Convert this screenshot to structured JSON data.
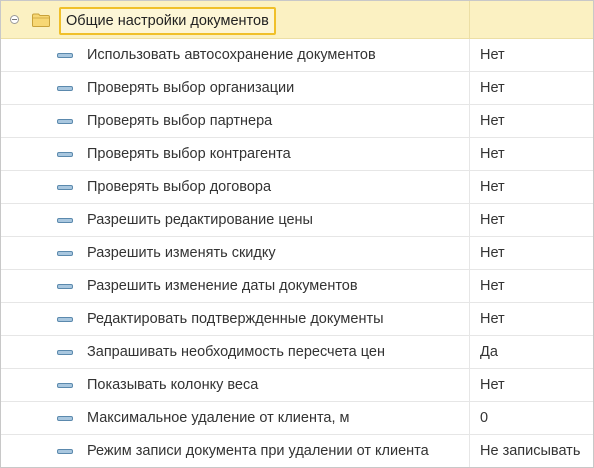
{
  "group": {
    "label": "Общие настройки документов",
    "expanded": true,
    "icon": "folder-icon",
    "accent_color": "#f0c02a",
    "background_color": "#fbf1c2"
  },
  "items": [
    {
      "label": "Использовать автосохранение документов",
      "value": "Нет"
    },
    {
      "label": "Проверять выбор организации",
      "value": "Нет"
    },
    {
      "label": "Проверять выбор партнера",
      "value": "Нет"
    },
    {
      "label": "Проверять выбор контрагента",
      "value": "Нет"
    },
    {
      "label": "Проверять выбор договора",
      "value": "Нет"
    },
    {
      "label": "Разрешить редактирование цены",
      "value": "Нет"
    },
    {
      "label": "Разрешить изменять скидку",
      "value": "Нет"
    },
    {
      "label": "Разрешить изменение даты документов",
      "value": "Нет"
    },
    {
      "label": "Редактировать подтвержденные документы",
      "value": "Нет"
    },
    {
      "label": "Запрашивать необходимость пересчета цен",
      "value": "Да"
    },
    {
      "label": "Показывать колонку веса",
      "value": "Нет"
    },
    {
      "label": "Максимальное удаление от клиента, м",
      "value": "0"
    },
    {
      "label": "Режим записи документа при удалении от клиента",
      "value": "Не записывать"
    }
  ]
}
